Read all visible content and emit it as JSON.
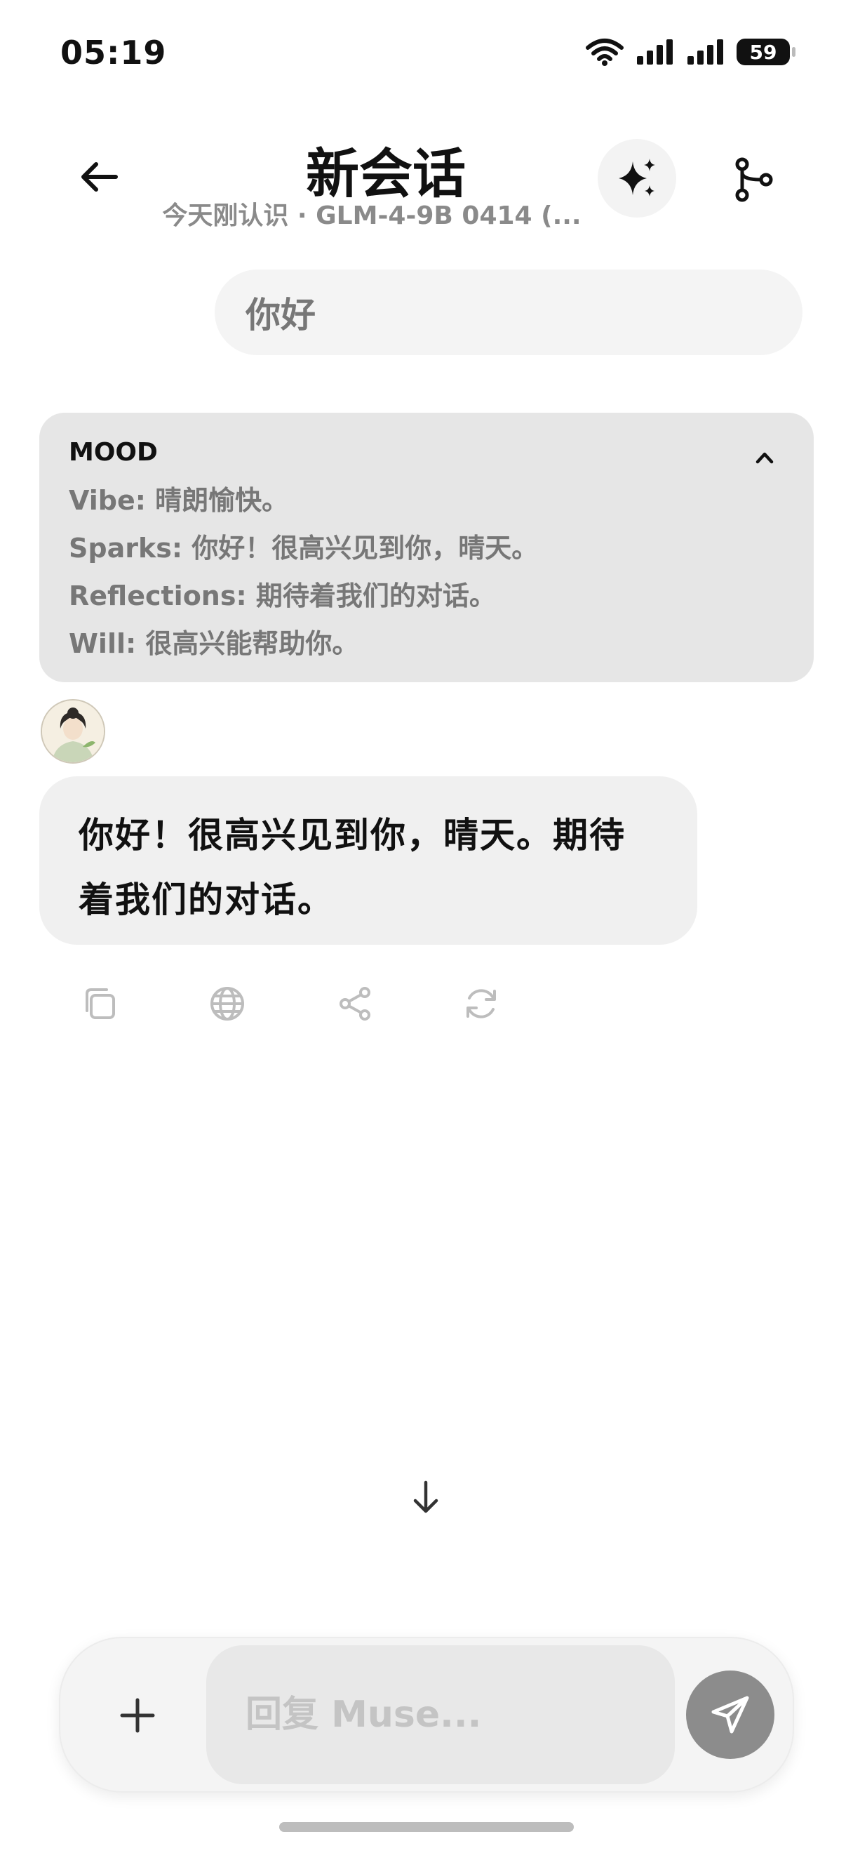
{
  "status_bar": {
    "time": "05:19",
    "battery": "59"
  },
  "header": {
    "title": "新会话",
    "subtitle": "今天刚认识 · GLM-4-9B 0414 (..."
  },
  "messages": {
    "user": "你好",
    "assistant": "你好！很高兴见到你，晴天。期待着我们的对话。"
  },
  "mood": {
    "title": "MOOD",
    "lines": [
      "Vibe: 晴朗愉快。",
      "Sparks: 你好！很高兴见到你，晴天。",
      "Reflections: 期待着我们的对话。",
      "Will: 很高兴能帮助你。"
    ]
  },
  "composer": {
    "placeholder": "回复 Muse..."
  },
  "colors": {
    "accent": "#8c8c8c",
    "bubble": "#f0f0f0",
    "mood_bg": "#e6e6e6"
  },
  "icons": [
    "back-arrow-icon",
    "sparkle-icon",
    "branch-icon",
    "chevron-up-icon",
    "copy-icon",
    "globe-icon",
    "share-icon",
    "refresh-icon",
    "arrow-down-icon",
    "plus-icon",
    "send-icon"
  ]
}
